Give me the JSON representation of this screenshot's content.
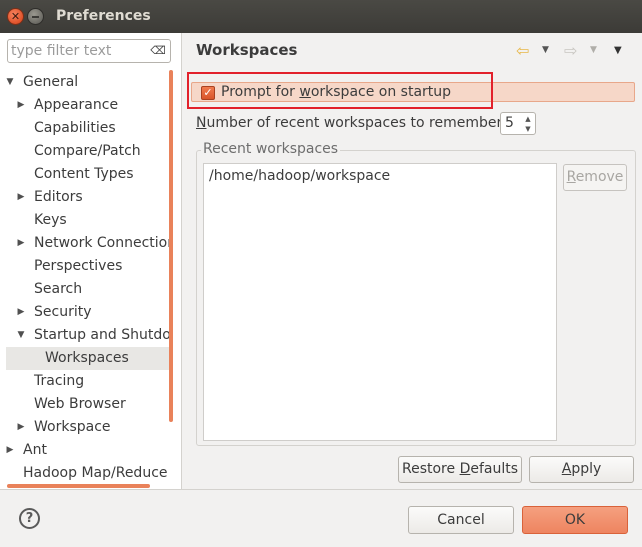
{
  "window": {
    "title": "Preferences",
    "close_glyph": "✕"
  },
  "filter": {
    "placeholder": "type filter text",
    "clear_glyph": "⌫"
  },
  "tree": [
    {
      "label": "General",
      "indent": 0,
      "arrow": "▼"
    },
    {
      "label": "Appearance",
      "indent": 1,
      "arrow": "▶"
    },
    {
      "label": "Capabilities",
      "indent": 1,
      "arrow": ""
    },
    {
      "label": "Compare/Patch",
      "indent": 1,
      "arrow": ""
    },
    {
      "label": "Content Types",
      "indent": 1,
      "arrow": ""
    },
    {
      "label": "Editors",
      "indent": 1,
      "arrow": "▶"
    },
    {
      "label": "Keys",
      "indent": 1,
      "arrow": ""
    },
    {
      "label": "Network Connection",
      "indent": 1,
      "arrow": "▶"
    },
    {
      "label": "Perspectives",
      "indent": 1,
      "arrow": ""
    },
    {
      "label": "Search",
      "indent": 1,
      "arrow": ""
    },
    {
      "label": "Security",
      "indent": 1,
      "arrow": "▶"
    },
    {
      "label": "Startup and Shutdown",
      "indent": 1,
      "arrow": "▼"
    },
    {
      "label": "Workspaces",
      "indent": 2,
      "arrow": "",
      "selected": true
    },
    {
      "label": "Tracing",
      "indent": 1,
      "arrow": ""
    },
    {
      "label": "Web Browser",
      "indent": 1,
      "arrow": ""
    },
    {
      "label": "Workspace",
      "indent": 1,
      "arrow": "▶"
    },
    {
      "label": "Ant",
      "indent": 0,
      "arrow": "▶"
    },
    {
      "label": "Hadoop Map/Reduce",
      "indent": 0,
      "arrow": ""
    }
  ],
  "page": {
    "title": "Workspaces",
    "nav_back_glyph": "⇦",
    "nav_fwd_glyph": "⇨",
    "dropdown_glyph": "▼",
    "prompt": {
      "before": "Prompt for ",
      "underline": "w",
      "after": "orkspace on startup",
      "checked": true,
      "check_glyph": "✓"
    },
    "recent_count": {
      "underline": "N",
      "after": "umber of recent workspaces to remember:",
      "value": "5",
      "up_glyph": "▲",
      "down_glyph": "▼"
    },
    "group_title": "Recent workspaces",
    "workspaces": [
      "/home/hadoop/workspace"
    ],
    "remove": {
      "underline": "R",
      "after": "emove"
    },
    "restore": {
      "before": "Restore ",
      "underline": "D",
      "after": "efaults"
    },
    "apply": {
      "underline": "A",
      "after": "pply"
    }
  },
  "footer": {
    "help_glyph": "?",
    "cancel": "Cancel",
    "ok": "OK"
  },
  "colors": {
    "accent": "#e9825a",
    "highlight_box": "#e2212b",
    "titlebar": "#3c3b37"
  }
}
